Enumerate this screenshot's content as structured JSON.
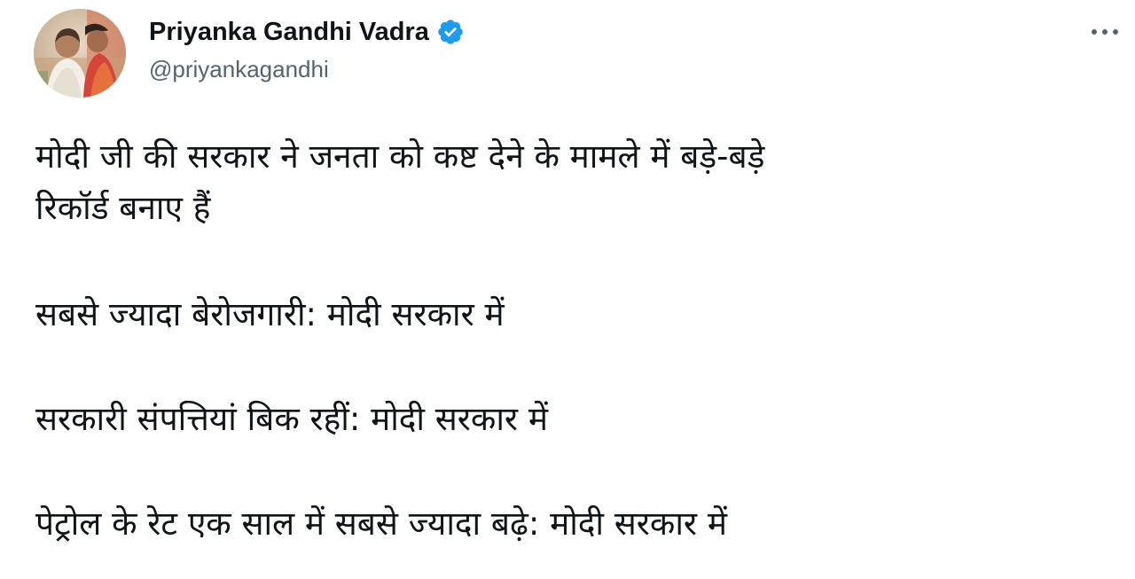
{
  "author": {
    "display_name": "Priyanka Gandhi Vadra",
    "handle": "@priyankagandhi",
    "verified": true,
    "verified_icon": "verified-badge-icon",
    "avatar_icon": "avatar-photo"
  },
  "actions": {
    "more_icon": "more-options-icon"
  },
  "tweet": {
    "line1": "मोदी जी की सरकार ने जनता को कष्ट देने के मामले में बड़े-बड़े",
    "line2": "रिकॉर्ड बनाए हैं",
    "line3": "सबसे ज्यादा बेरोजगारी: मोदी सरकार में",
    "line4": "सरकारी संपत्तियां बिक रहीं: मोदी सरकार में",
    "line5": "पेट्रोल के रेट एक साल में सबसे ज्यादा बढ़े: मोदी सरकार में"
  },
  "colors": {
    "text_primary": "#0f1419",
    "text_secondary": "#536471",
    "verified_blue": "#1d9bf0",
    "background": "#ffffff"
  }
}
